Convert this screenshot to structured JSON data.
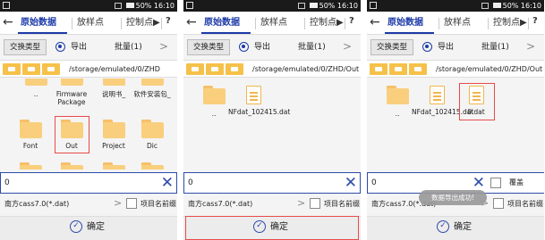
{
  "status": {
    "text": "50% 16:10"
  },
  "tabs": {
    "raw_data": "原始数据",
    "stakeout": "放样点",
    "control": "控制点▶",
    "help": "?"
  },
  "options": {
    "exchange_type": "交换类型",
    "export": "导出",
    "batch": "批量(1)",
    "chevron": ">"
  },
  "panels": [
    {
      "path": "/storage/emulated/0/ZHD",
      "files": [
        {
          "name": "..",
          "type": "folder"
        },
        {
          "name": "Firmware Package",
          "type": "folder"
        },
        {
          "name": "说明书_",
          "type": "folder"
        },
        {
          "name": "软件安装包_",
          "type": "folder"
        },
        {
          "name": "Font",
          "type": "folder"
        },
        {
          "name": "Out",
          "type": "folder",
          "highlighted": true
        },
        {
          "name": "Project",
          "type": "folder"
        },
        {
          "name": "Dic",
          "type": "folder"
        }
      ],
      "input": "0",
      "format": "南方cass7.0(*.dat)",
      "check_label": "项目名前缀",
      "confirm": "确定"
    },
    {
      "path": "/storage/emulated/0/ZHD/Out",
      "files": [
        {
          "name": "..",
          "type": "folder"
        },
        {
          "name": "NFdat_102415.dat",
          "type": "file"
        }
      ],
      "input": "0",
      "format": "南方cass7.0(*.dat)",
      "check_label": "项目名前缀",
      "confirm": "确定"
    },
    {
      "path": "/storage/emulated/0/ZHD/Out",
      "files": [
        {
          "name": "..",
          "type": "folder"
        },
        {
          "name": "NFdat_102415.dat",
          "type": "file"
        },
        {
          "name": "0.dat",
          "type": "file",
          "highlighted": true
        }
      ],
      "input": "0",
      "overwrite_label": "覆盖",
      "format": "南方cass7.0(*.dat)",
      "check_label": "项目名前缀",
      "toast": "数据导出成功!",
      "confirm": "确定"
    }
  ],
  "icons": [
    "back-arrow-icon",
    "radio-selected-icon",
    "folder-icon",
    "file-icon",
    "clear-x-icon",
    "checkbox-icon",
    "confirm-check-icon"
  ],
  "colors": {
    "accent": "#1c3aa8",
    "folder": "#f9cf7d",
    "highlight": "#e84a4a"
  }
}
